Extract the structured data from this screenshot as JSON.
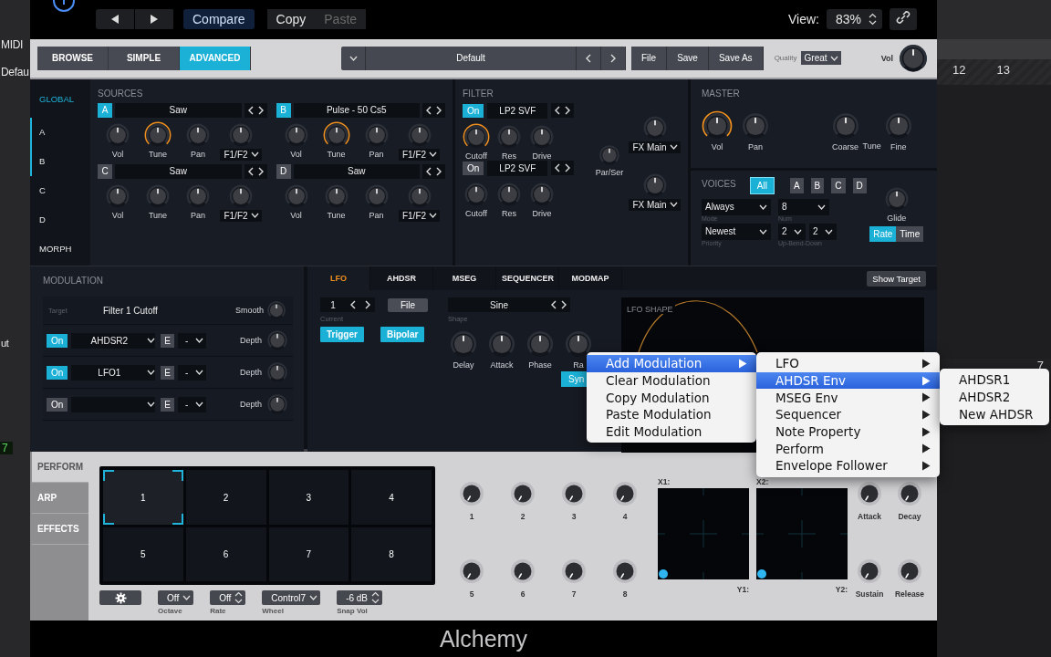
{
  "host": {
    "left_labels": [
      "MIDI",
      "Defau",
      "ut"
    ],
    "left_counter": "7",
    "ruler_marks": [
      "12",
      "13"
    ],
    "track_marker": "7"
  },
  "header": {
    "buttons": [
      {
        "label": "Compare",
        "selected": true,
        "disabled": false
      },
      {
        "label": "Copy",
        "selected": false,
        "disabled": false
      },
      {
        "label": "Paste",
        "selected": false,
        "disabled": true
      }
    ],
    "view_label": "View:",
    "view_value": "83%"
  },
  "preset_bar": {
    "modes": [
      {
        "label": "BROWSE",
        "selected": false
      },
      {
        "label": "SIMPLE",
        "selected": false
      },
      {
        "label": "ADVANCED",
        "selected": true
      }
    ],
    "preset": "Default",
    "file_buttons": [
      "File",
      "Save",
      "Save As"
    ],
    "quality_label": "Quality",
    "quality_value": "Great",
    "vol_label": "Vol"
  },
  "sidebar": [
    {
      "label": "GLOBAL",
      "selected": true,
      "on": false
    },
    {
      "label": "A",
      "selected": false,
      "on": true
    },
    {
      "label": "B",
      "selected": false,
      "on": true
    },
    {
      "label": "C",
      "selected": false,
      "on": false
    },
    {
      "label": "D",
      "selected": false,
      "on": false
    },
    {
      "label": "MORPH",
      "selected": false,
      "on": false
    }
  ],
  "sources": {
    "title": "SOURCES",
    "items": [
      {
        "letter": "A",
        "on": true,
        "name": "Saw",
        "knobs": [
          {
            "label": "Vol"
          },
          {
            "label": "Tune",
            "modulated": true
          },
          {
            "label": "Pan"
          }
        ],
        "route": "F1/F2"
      },
      {
        "letter": "B",
        "on": true,
        "name": "Pulse - 50 Cs5",
        "knobs": [
          {
            "label": "Vol"
          },
          {
            "label": "Tune",
            "modulated": true
          },
          {
            "label": "Pan"
          }
        ],
        "route": "F1/F2"
      },
      {
        "letter": "C",
        "on": false,
        "name": "Saw",
        "knobs": [
          {
            "label": "Vol"
          },
          {
            "label": "Tune"
          },
          {
            "label": "Pan"
          }
        ],
        "route": "F1/F2"
      },
      {
        "letter": "D",
        "on": false,
        "name": "Saw",
        "knobs": [
          {
            "label": "Vol"
          },
          {
            "label": "Tune"
          },
          {
            "label": "Pan"
          }
        ],
        "route": "F1/F2"
      }
    ]
  },
  "filter": {
    "title": "FILTER",
    "items": [
      {
        "on": true,
        "label": "On",
        "type": "LP2 SVF",
        "knobs": [
          {
            "label": "Cutoff",
            "modulated": true
          },
          {
            "label": "Res"
          },
          {
            "label": "Drive"
          }
        ],
        "fx_route": "FX Main"
      },
      {
        "on": false,
        "label": "On",
        "type": "LP2 SVF",
        "knobs": [
          {
            "label": "Cutoff"
          },
          {
            "label": "Res"
          },
          {
            "label": "Drive"
          }
        ],
        "fx_route": "FX Main"
      }
    ],
    "par_ser": {
      "label": "Par/Ser"
    }
  },
  "master": {
    "title": "MASTER",
    "knobs": [
      {
        "label": "Vol",
        "modulated": true
      },
      {
        "label": "Pan"
      }
    ],
    "tune_knobs": [
      {
        "label": "Coarse"
      },
      {
        "label": "Fine"
      }
    ],
    "tune_label": "Tune"
  },
  "voices": {
    "title": "VOICES",
    "modes": [
      {
        "label": "All",
        "selected": true
      },
      {
        "label": "A",
        "selected": false
      },
      {
        "label": "B",
        "selected": false
      },
      {
        "label": "C",
        "selected": false
      },
      {
        "label": "D",
        "selected": false
      }
    ],
    "mode": {
      "value": "Always",
      "label": "Mode"
    },
    "num": {
      "value": "8",
      "label": "Num"
    },
    "priority": {
      "value": "Newest",
      "label": "Priority"
    },
    "bend_up": "2",
    "bend_down": "2",
    "bend_label": "Up-Bend-Down",
    "glide": {
      "label": "Glide"
    },
    "glide_modes": [
      {
        "label": "Rate",
        "selected": true
      },
      {
        "label": "Time",
        "selected": false
      }
    ]
  },
  "modulation": {
    "title": "MODULATION",
    "target_label": "Target",
    "target": "Filter 1 Cutoff",
    "smooth_label": "Smooth",
    "rows": [
      {
        "on": true,
        "label": "On",
        "source": "AHDSR2",
        "e": "E",
        "value": "-",
        "depth_label": "Depth"
      },
      {
        "on": true,
        "label": "On",
        "source": "LFO1",
        "e": "E",
        "value": "-",
        "depth_label": "Depth"
      },
      {
        "on": false,
        "label": "On",
        "e": "E",
        "value": "-",
        "depth_label": "Depth"
      }
    ]
  },
  "mod_tabs": [
    {
      "label": "LFO",
      "selected": true
    },
    {
      "label": "AHDSR",
      "selected": false
    },
    {
      "label": "MSEG",
      "selected": false
    },
    {
      "label": "SEQUENCER",
      "selected": false
    },
    {
      "label": "MODMAP",
      "selected": false
    }
  ],
  "show_target": "Show Target",
  "lfo": {
    "index": "1",
    "current_label": "Current",
    "file": "File",
    "toggles": [
      {
        "label": "Trigger",
        "on": true
      },
      {
        "label": "Bipolar",
        "on": true
      }
    ],
    "shape": "Sine",
    "shape_label": "Shape",
    "knobs": [
      {
        "label": "Delay"
      },
      {
        "label": "Attack"
      },
      {
        "label": "Phase"
      },
      {
        "label": "Ra"
      }
    ],
    "sync": "Syn",
    "shape_title": "LFO SHAPE"
  },
  "perform": {
    "tabs": [
      {
        "label": "PERFORM",
        "selected": true
      },
      {
        "label": "ARP",
        "selected": false
      },
      {
        "label": "EFFECTS",
        "selected": false
      }
    ],
    "pads": [
      {
        "label": "1",
        "selected": true
      },
      {
        "label": "2",
        "selected": false
      },
      {
        "label": "3",
        "selected": false
      },
      {
        "label": "4",
        "selected": false
      },
      {
        "label": "5",
        "selected": false
      },
      {
        "label": "6",
        "selected": false
      },
      {
        "label": "7",
        "selected": false
      },
      {
        "label": "8",
        "selected": false
      }
    ],
    "controls": [
      {
        "kind": "dropdown",
        "value": "Off",
        "label": "Octave"
      },
      {
        "kind": "stepper",
        "value": "Off",
        "label": "Rate"
      },
      {
        "kind": "dropdown",
        "value": "Control7",
        "label": "Wheel"
      },
      {
        "kind": "stepper",
        "value": "-6 dB",
        "label": "Snap Vol"
      }
    ],
    "knobs": [
      {
        "label": "1"
      },
      {
        "label": "2"
      },
      {
        "label": "3"
      },
      {
        "label": "4"
      },
      {
        "label": "5"
      },
      {
        "label": "6"
      },
      {
        "label": "7"
      },
      {
        "label": "8"
      }
    ],
    "xy_pads": [
      {
        "x_label": "X1:",
        "y_label": "Y1:"
      },
      {
        "x_label": "X2:",
        "y_label": "Y2:"
      }
    ],
    "envelope": [
      {
        "label": "Attack"
      },
      {
        "label": "Decay"
      },
      {
        "label": "Sustain"
      },
      {
        "label": "Release"
      }
    ]
  },
  "footer": {
    "title": "Alchemy"
  },
  "context_menu": {
    "items": [
      {
        "label": "Add Modulation",
        "submenu": true,
        "selected": true
      },
      {
        "label": "Clear Modulation",
        "submenu": false,
        "selected": false
      },
      {
        "label": "Copy Modulation",
        "submenu": false,
        "selected": false
      },
      {
        "label": "Paste Modulation",
        "submenu": false,
        "selected": false
      },
      {
        "label": "Edit Modulation",
        "submenu": false,
        "selected": false
      }
    ],
    "submenu": [
      {
        "label": "LFO",
        "submenu": true,
        "selected": false
      },
      {
        "label": "AHDSR Env",
        "submenu": true,
        "selected": true
      },
      {
        "label": "MSEG Env",
        "submenu": true,
        "selected": false
      },
      {
        "label": "Sequencer",
        "submenu": true,
        "selected": false
      },
      {
        "label": "Note Property",
        "submenu": true,
        "selected": false
      },
      {
        "label": "Perform",
        "submenu": true,
        "selected": false
      },
      {
        "label": "Envelope Follower",
        "submenu": true,
        "selected": false
      }
    ],
    "submenu_2": [
      {
        "label": "AHDSR1",
        "submenu": false,
        "selected": false
      },
      {
        "label": "AHDSR2",
        "submenu": false,
        "selected": false
      },
      {
        "label": "New AHDSR",
        "submenu": false,
        "selected": false
      }
    ]
  }
}
